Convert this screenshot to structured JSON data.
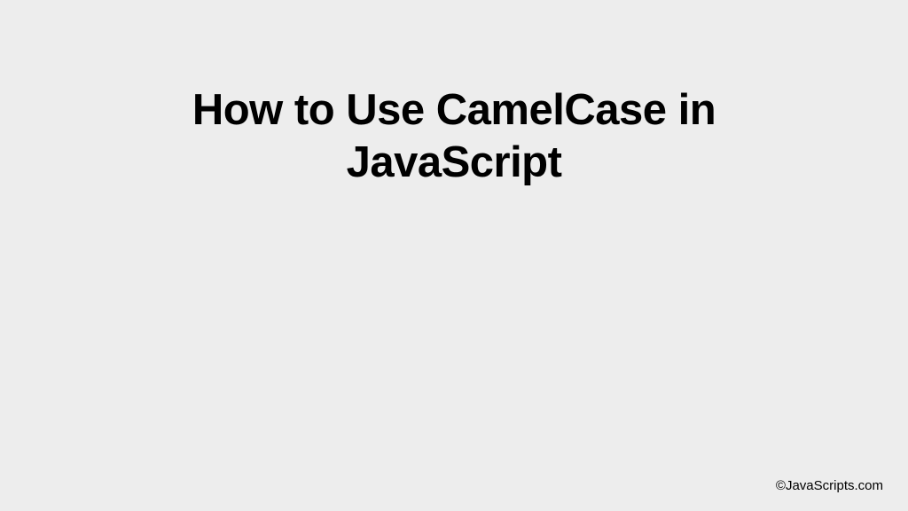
{
  "heading": {
    "title": "How to Use CamelCase in JavaScript"
  },
  "footer": {
    "credit": "©JavaScripts.com"
  }
}
